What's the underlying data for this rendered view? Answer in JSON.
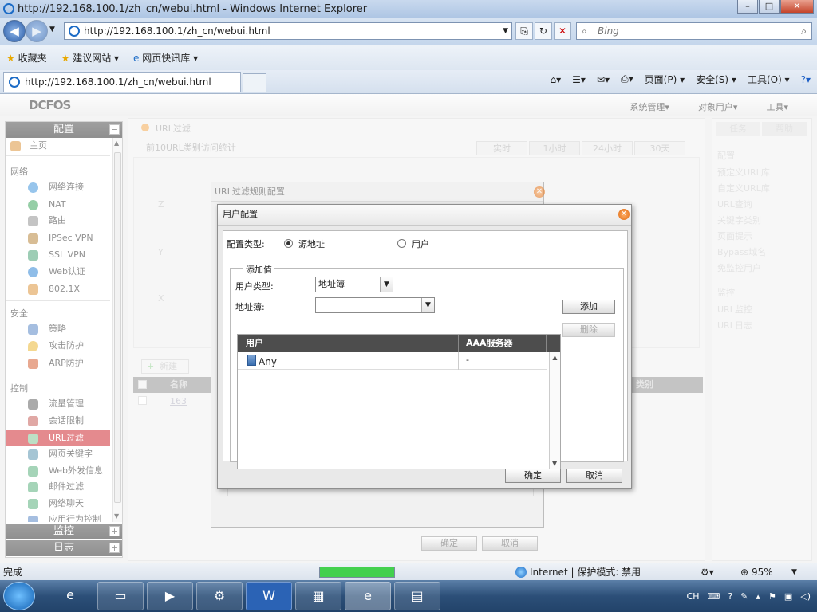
{
  "browser": {
    "title": "http://192.168.100.1/zh_cn/webui.html - Windows Internet Explorer",
    "url": "http://192.168.100.1/zh_cn/webui.html",
    "search_placeholder": "Bing",
    "tab_label": "http://192.168.100.1/zh_cn/webui.html",
    "favorites": [
      "收藏夹",
      "建议网站 ▾",
      "网页快讯库 ▾"
    ],
    "commands": [
      "页面(P) ▾",
      "安全(S) ▾",
      "工具(O) ▾"
    ],
    "status_text": "完成",
    "zone_text": "Internet | 保护模式: 禁用",
    "zoom": "95%",
    "progress": 1.0
  },
  "app": {
    "logo": "DCFOS",
    "top_menu": [
      "系统管理▾",
      "对象用户▾",
      "工具▾"
    ]
  },
  "sidebar": {
    "config_header": "配置",
    "monitor_header": "监控",
    "log_header": "日志",
    "home": "主页",
    "sections": {
      "network": "网络",
      "security": "安全",
      "control": "控制"
    },
    "network_items": [
      "网络连接",
      "NAT",
      "路由",
      "IPSec VPN",
      "SSL VPN",
      "Web认证",
      "802.1X"
    ],
    "security_items": [
      "策略",
      "攻击防护",
      "ARP防护"
    ],
    "control_items": [
      "流量管理",
      "会话限制",
      "URL过滤",
      "网页关键字",
      "Web外发信息",
      "邮件过滤",
      "网络聊天",
      "应用行为控制"
    ],
    "active_item": "URL过滤"
  },
  "background": {
    "main_title": "URL过滤",
    "sub_title": "前10URL类别访问统计",
    "time_tabs": [
      "实时",
      "1小时",
      "24小时",
      "30天"
    ],
    "y_labels": [
      "Z",
      "Y",
      "X"
    ],
    "add_button": "新建",
    "table_headers": [
      "名称",
      "类别"
    ],
    "table_row": "163",
    "right_tabs": [
      "任务",
      "帮助"
    ],
    "right_sections": {
      "config": "配置",
      "monitor": "监控"
    },
    "right_config_items": [
      "预定义URL库",
      "自定义URL库",
      "URL查询",
      "关键字类别",
      "页面提示",
      "Bypass域名",
      "免监控用户"
    ],
    "right_monitor_items": [
      "URL监控",
      "URL日志"
    ],
    "bg_dialog_title": "URL过滤规则配置",
    "bg_ok": "确定",
    "bg_cancel": "取消"
  },
  "dialog": {
    "title": "用户配置",
    "config_type_label": "配置类型:",
    "radio_source": "源地址",
    "radio_user": "用户",
    "fieldset_legend": "添加值",
    "user_type_label": "用户类型:",
    "user_type_value": "地址簿",
    "addressbook_label": "地址簿:",
    "addressbook_value": "",
    "add_button": "添加",
    "delete_button": "删除",
    "grid_headers": [
      "用户",
      "AAA服务器"
    ],
    "grid_rows": [
      {
        "user": "Any",
        "aaa": "-"
      }
    ],
    "ok_button": "确定",
    "cancel_button": "取消"
  },
  "taskbar": {
    "ime": "CH",
    "apps": [
      "ie",
      "explorer",
      "media",
      "tool",
      "wps",
      "network",
      "ie-active",
      "doc"
    ]
  },
  "colors": {
    "accent_red": "#c8141c",
    "header_dark": "#2a2a2a",
    "close_orange": "#e06a10"
  }
}
